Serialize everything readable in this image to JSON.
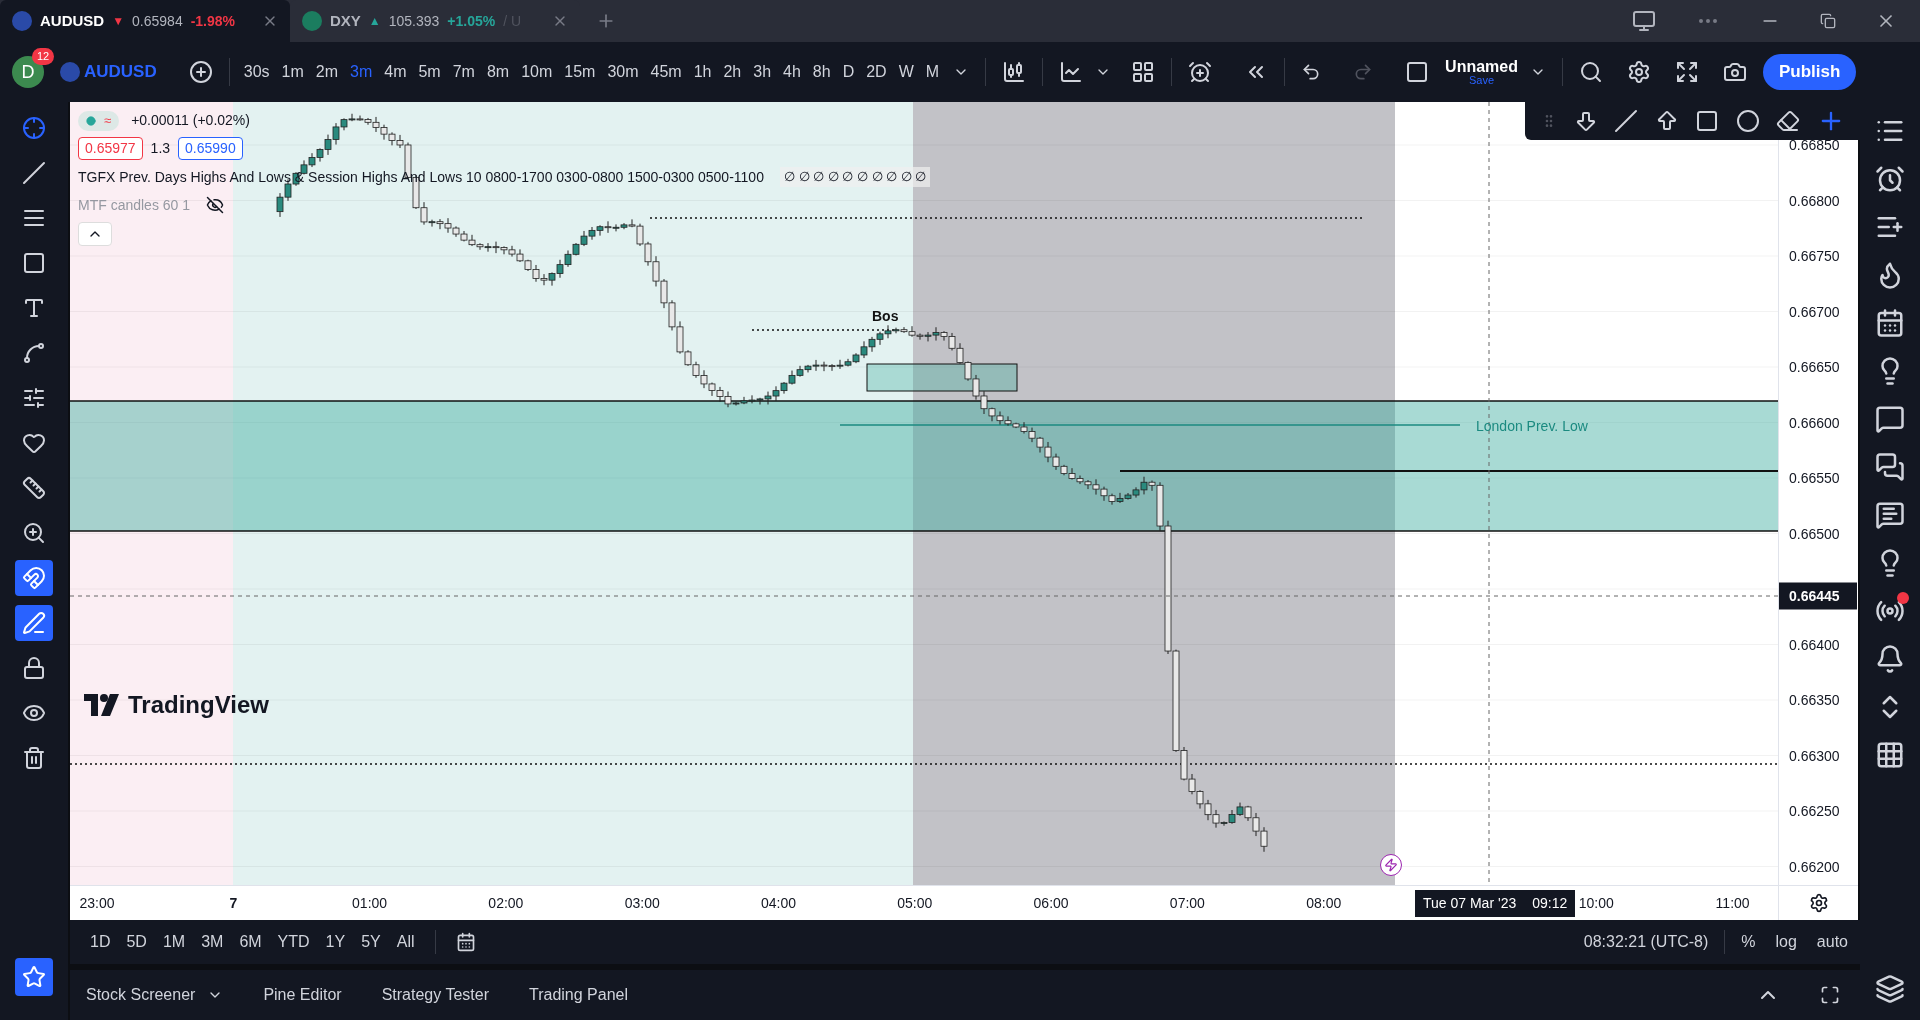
{
  "tabs": [
    {
      "symbol": "AUDUSD",
      "arrow": "▼",
      "color": "#f23645",
      "price": "0.65984",
      "change": "-1.98%",
      "selected": true
    },
    {
      "symbol": "DXY",
      "arrow": "▲",
      "color": "#26a69a",
      "price": "105.393",
      "change": "+1.05%",
      "suffix": "/ U",
      "selected": false
    }
  ],
  "toolbar": {
    "avatar": "D",
    "notifications": "12",
    "symbol": "AUDUSD",
    "intervals": [
      {
        "label": "30s",
        "selected": false
      },
      {
        "label": "1m",
        "selected": false
      },
      {
        "label": "2m",
        "selected": false
      },
      {
        "label": "3m",
        "selected": true
      },
      {
        "label": "4m",
        "selected": false
      },
      {
        "label": "5m",
        "selected": false
      },
      {
        "label": "7m",
        "selected": false
      },
      {
        "label": "8m",
        "selected": false
      },
      {
        "label": "10m",
        "selected": false
      },
      {
        "label": "15m",
        "selected": false
      },
      {
        "label": "30m",
        "selected": false
      },
      {
        "label": "45m",
        "selected": false
      },
      {
        "label": "1h",
        "selected": false
      },
      {
        "label": "2h",
        "selected": false
      },
      {
        "label": "3h",
        "selected": false
      },
      {
        "label": "4h",
        "selected": false
      },
      {
        "label": "8h",
        "selected": false
      },
      {
        "label": "D",
        "selected": false
      },
      {
        "label": "2D",
        "selected": false
      },
      {
        "label": "W",
        "selected": false
      },
      {
        "label": "M",
        "selected": false
      }
    ],
    "layout": {
      "name": "Unnamed",
      "status": "Save"
    },
    "publish": "Publish"
  },
  "drawing_tools": [
    {
      "active": true
    },
    {
      "active": false
    },
    {
      "active": false
    },
    {
      "active": false
    },
    {
      "active": false
    },
    {
      "active": false
    },
    {
      "active": false
    },
    {
      "active": false
    },
    {
      "active": false
    },
    {
      "active": false
    },
    {
      "active": true
    },
    {
      "active": true
    },
    {
      "active": false
    },
    {
      "active": false
    },
    {
      "active": false
    }
  ],
  "legend": {
    "status_icon": "≈",
    "change": "+0.00011 (+0.02%)",
    "bid": "0.65977",
    "spread": "1.3",
    "ask": "0.65990",
    "indicators": [
      {
        "text": "TGFX Prev. Days Highs And Lows & Session Highs And Lows 10 0800-1700 0300-0800 1500-0300 0500-1100",
        "values": "∅ ∅ ∅ ∅ ∅ ∅ ∅ ∅ ∅ ∅",
        "hidden": false
      },
      {
        "text": "MTF candles 60 1",
        "hidden": true
      }
    ]
  },
  "chart": {
    "labels": [
      {
        "kind": "bos",
        "text": "Bos"
      },
      {
        "kind": "level",
        "text": "London Prev. Low"
      }
    ],
    "logo": "TradingView"
  },
  "price_axis": {
    "ticks": [
      "0.66850",
      "0.66800",
      "0.66750",
      "0.66700",
      "0.66650",
      "0.66600",
      "0.66550",
      "0.66500",
      "0.66400",
      "0.66350",
      "0.66300",
      "0.66250",
      "0.66200"
    ],
    "crosshair": "0.66445"
  },
  "time_axis": {
    "ticks": [
      "23:00",
      "7",
      "01:00",
      "02:00",
      "03:00",
      "04:00",
      "05:00",
      "06:00",
      "07:00",
      "08:00",
      "10:00",
      "11:00"
    ],
    "crosshair_date": "Tue 07 Mar '23",
    "crosshair_time": "09:12"
  },
  "ranges": [
    "1D",
    "5D",
    "1M",
    "3M",
    "6M",
    "YTD",
    "1Y",
    "5Y",
    "All"
  ],
  "status": {
    "clock": "08:32:21 (UTC-8)",
    "percent": "%",
    "log": "log",
    "auto": "auto"
  },
  "bottom_tabs": [
    "Stock Screener",
    "Pine Editor",
    "Strategy Tester",
    "Trading Panel"
  ]
}
